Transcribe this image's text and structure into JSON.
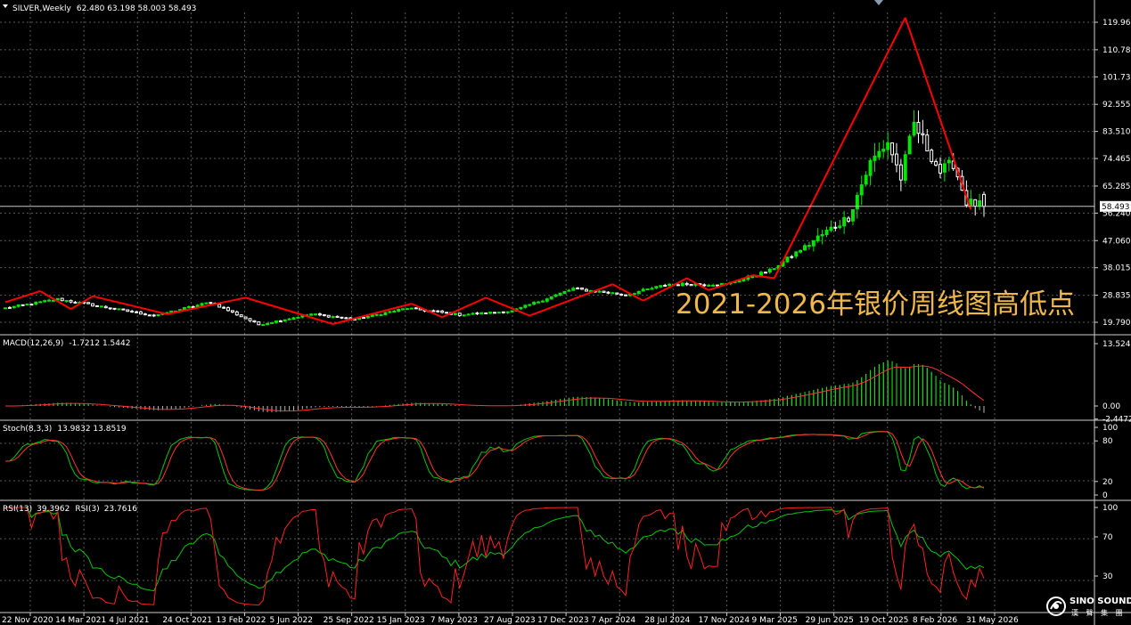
{
  "header": {
    "symbol_line": "SILVER,Weekly",
    "ohlc": "62.480 63.198 58.003 58.493"
  },
  "watermark": "2021-2026年银价周线图高低点",
  "logo": {
    "brand": "SINO SOUND",
    "sub": "漢 聲 集 團"
  },
  "colors": {
    "bull": "#00e600",
    "bear": "#ffffff",
    "zigzag": "#ff0000",
    "macd_signal": "#ff3333",
    "stoch_main": "#00c800",
    "stoch_signal": "#ff3333",
    "rsi13": "#00c800",
    "rsi3": "#ff2020",
    "grid": "#5a5a5a",
    "background": "#000000"
  },
  "chart_data": [
    {
      "type": "candlestick",
      "panel": "price",
      "title": "SILVER,Weekly",
      "ylim": [
        14.0,
        124.0
      ],
      "y_ticks": [
        "119.960",
        "110.780",
        "101.735",
        "92.555",
        "83.510",
        "74.465",
        "65.285",
        "56.240",
        "47.060",
        "38.015",
        "28.835",
        "19.790"
      ],
      "current_price_label": "58.493",
      "x_labels": [
        "22 Nov 2020",
        "14 Mar 2021",
        "4 Jul 2021",
        "24 Oct 2021",
        "13 Feb 2022",
        "5 Jun 2022",
        "25 Sep 2022",
        "15 Jan 2023",
        "7 May 2023",
        "27 Aug 2023",
        "17 Dec 2023",
        "7 Apr 2024",
        "28 Jul 2024",
        "17 Nov 2024",
        "9 Mar 2025",
        "29 Jun 2025",
        "19 Oct 2025",
        "8 Feb 2026",
        "31 May 2026"
      ],
      "close_anchors": [
        [
          0,
          24.5
        ],
        [
          12,
          27.5
        ],
        [
          22,
          25.0
        ],
        [
          34,
          22.0
        ],
        [
          47,
          26.5
        ],
        [
          58,
          19.0
        ],
        [
          70,
          22.5
        ],
        [
          80,
          20.8
        ],
        [
          92,
          24.5
        ],
        [
          104,
          22.3
        ],
        [
          116,
          23.5
        ],
        [
          130,
          31.0
        ],
        [
          142,
          29.0
        ],
        [
          152,
          32.5
        ],
        [
          165,
          32.5
        ],
        [
          175,
          37.0
        ],
        [
          185,
          47.0
        ],
        [
          193,
          55.0
        ],
        [
          198,
          73.0
        ],
        [
          202,
          80.0
        ],
        [
          205,
          68.0
        ],
        [
          208,
          86.0
        ],
        [
          211,
          78.0
        ],
        [
          214,
          70.0
        ],
        [
          217,
          73.0
        ],
        [
          220,
          60.0
        ],
        [
          224,
          58.5
        ]
      ],
      "zigzag": [
        [
          0,
          26.5
        ],
        [
          8,
          30.2
        ],
        [
          15,
          24.2
        ],
        [
          20,
          28.5
        ],
        [
          37,
          22.5
        ],
        [
          55,
          28.0
        ],
        [
          75,
          19.2
        ],
        [
          93,
          26.0
        ],
        [
          100,
          21.5
        ],
        [
          110,
          28.0
        ],
        [
          120,
          22.0
        ],
        [
          139,
          32.5
        ],
        [
          146,
          27.0
        ],
        [
          156,
          34.5
        ],
        [
          161,
          30.5
        ],
        [
          171,
          35.5
        ],
        [
          176,
          34.5
        ],
        [
          206,
          121.5
        ],
        [
          221,
          57.5
        ]
      ]
    },
    {
      "type": "bar",
      "panel": "macd",
      "title": "MACD(12,26,9)",
      "readout": "-1.7212 1.5442",
      "y_ticks": [
        "13.5245",
        "0.00",
        "-2.4472"
      ],
      "ylim": [
        -2.4472,
        13.5245
      ]
    },
    {
      "type": "line",
      "panel": "stochastic",
      "title": "Stoch(8,3,3)",
      "readout": "13.9832 13.8519",
      "y_ticks": [
        "100",
        "80",
        "20",
        "0"
      ],
      "ylim": [
        0,
        100
      ],
      "series": [
        {
          "name": "Main"
        },
        {
          "name": "Signal"
        }
      ]
    },
    {
      "type": "line",
      "panel": "rsi",
      "title": "RSI(13)",
      "readout": "39.3962",
      "title2": "RSI(3)",
      "readout2": "23.7616",
      "y_ticks": [
        "100",
        "70",
        "30"
      ],
      "ylim": [
        0,
        100
      ],
      "series": [
        {
          "name": "RSI(13)"
        },
        {
          "name": "RSI(3)"
        }
      ]
    }
  ]
}
